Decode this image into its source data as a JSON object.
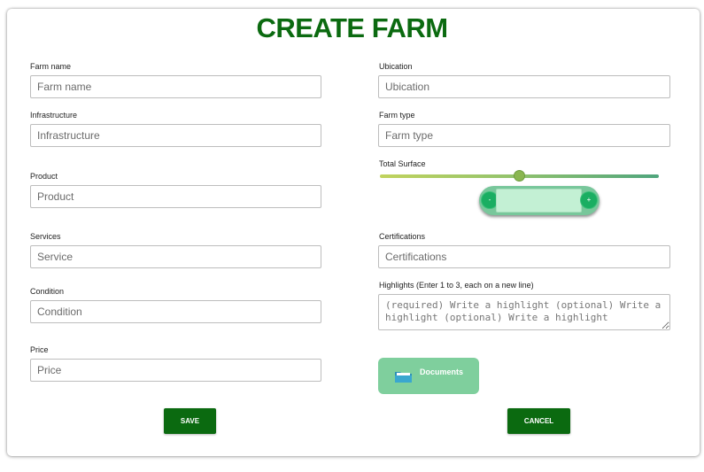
{
  "page_title": "CREATE FARM",
  "fields": {
    "farm_name": {
      "label": "Farm name",
      "placeholder": "Farm name",
      "value": ""
    },
    "ubication": {
      "label": "Ubication",
      "placeholder": "Ubication",
      "value": ""
    },
    "infrastructure": {
      "label": "Infrastructure",
      "placeholder": "Infrastructure",
      "value": ""
    },
    "farm_type": {
      "label": "Farm type",
      "placeholder": "Farm type",
      "value": ""
    },
    "product": {
      "label": "Product",
      "placeholder": "Product",
      "value": ""
    },
    "services": {
      "label": "Services",
      "placeholder": "Service",
      "value": ""
    },
    "certifications": {
      "label": "Certifications",
      "placeholder": "Certifications",
      "value": ""
    },
    "condition": {
      "label": "Condition",
      "placeholder": "Condition",
      "value": ""
    },
    "highlights": {
      "label": "Highlights (Enter 1 to 3, each on a new line)",
      "placeholder": "(required) Write a highlight (optional) Write a highlight (optional) Write a highlight",
      "value": ""
    },
    "price": {
      "label": "Price",
      "placeholder": "Price",
      "value": ""
    }
  },
  "total_surface": {
    "label": "Total Surface",
    "slider_level": 0.5,
    "decrement_label": "-",
    "increment_label": "+",
    "value": ""
  },
  "documents": {
    "label": "Documents",
    "icon": "folder-icon"
  },
  "actions": {
    "save_label": "SAVE",
    "cancel_label": "CANCEL"
  },
  "colors": {
    "title": "#0b6a10",
    "primary_button": "#0b6a10",
    "documents_button": "#7fcf9d",
    "stepper": "#78c79b",
    "stepper_buttons": "#1aae62"
  }
}
